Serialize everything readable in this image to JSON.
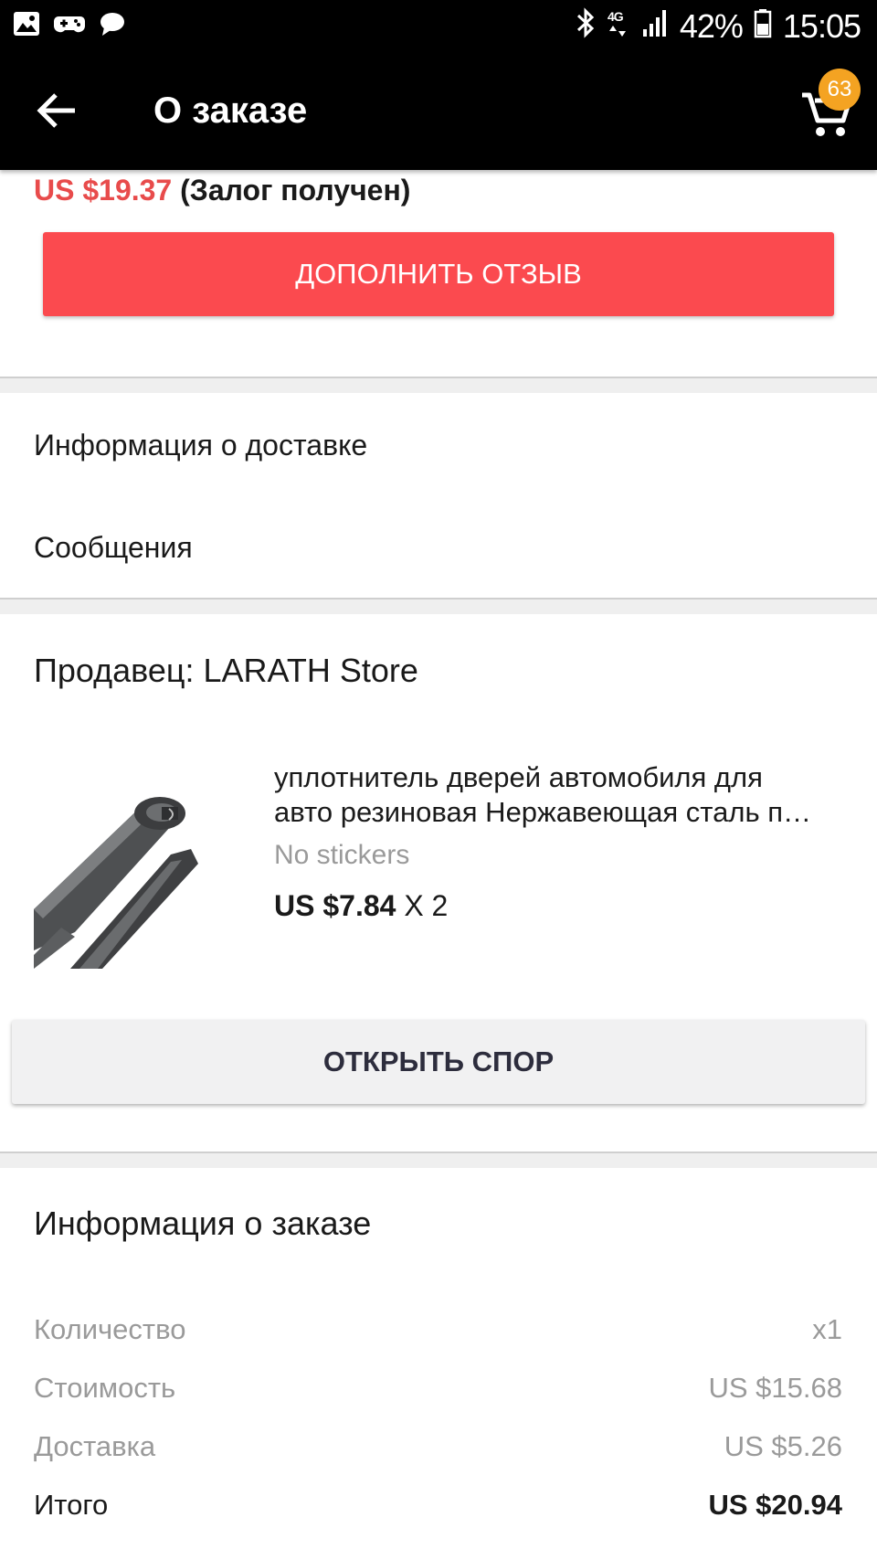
{
  "status_bar": {
    "battery": "42%",
    "time": "15:05",
    "network": "4G"
  },
  "app_bar": {
    "title": "О заказе",
    "cart_count": "63"
  },
  "deposit": {
    "price": "US $19.37",
    "status": "(Залог получен)"
  },
  "review_button_label": "ДОПОЛНИТЬ ОТЗЫВ",
  "links": {
    "delivery_info": "Информация о доставке",
    "messages": "Сообщения"
  },
  "seller": {
    "title": "Продавец: LARATH Store"
  },
  "product": {
    "name_line1": "уплотнитель дверей автомобиля для",
    "name_line2": "авто резиновая Нержавеющая сталь п…",
    "variant": "No stickers",
    "price": "US $7.84",
    "quantity": "X 2"
  },
  "dispute_button_label": "ОТКРЫТЬ СПОР",
  "order_info": {
    "title": "Информация о заказе",
    "rows": [
      {
        "label": "Количество",
        "value": "x1"
      },
      {
        "label": "Стоимость",
        "value": "US $15.68"
      },
      {
        "label": "Доставка",
        "value": "US $5.26"
      },
      {
        "label": "Итого",
        "value": "US $20.94"
      }
    ]
  },
  "colors": {
    "accent_red": "#fb4a4f",
    "price_red": "#e84b4b",
    "badge_orange": "#f4a322",
    "bar_black": "#000000"
  },
  "icons": {
    "status_left": [
      "gallery-icon",
      "game-controller-icon",
      "chat-bubble-icon"
    ],
    "status_right": [
      "bluetooth-icon",
      "network-4g-icon",
      "signal-icon",
      "battery-icon"
    ],
    "app_bar": [
      "back-arrow-icon",
      "cart-icon"
    ]
  }
}
